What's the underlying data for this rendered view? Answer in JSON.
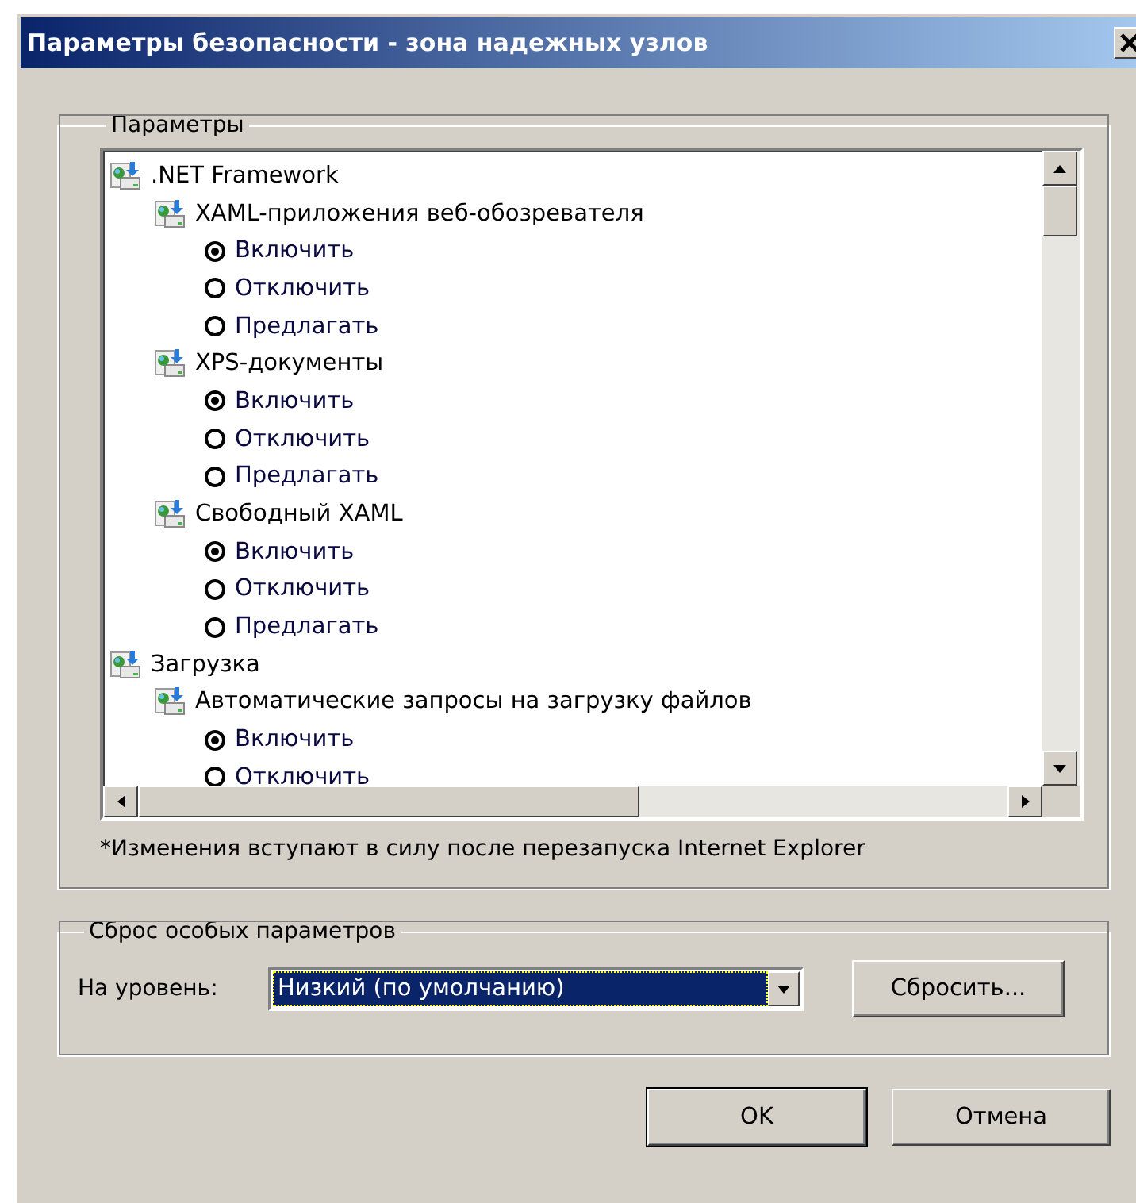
{
  "window": {
    "title": "Параметры безопасности - зона надежных узлов"
  },
  "settings_group": {
    "label": "Параметры",
    "tree": [
      {
        "kind": "group",
        "label": ".NET Framework",
        "children": [
          {
            "kind": "group",
            "label": "XAML-приложения веб-обозревателя",
            "children": [
              {
                "kind": "radio",
                "label": "Включить",
                "selected": true
              },
              {
                "kind": "radio",
                "label": "Отключить",
                "selected": false
              },
              {
                "kind": "radio",
                "label": "Предлагать",
                "selected": false
              }
            ]
          },
          {
            "kind": "group",
            "label": "XPS-документы",
            "children": [
              {
                "kind": "radio",
                "label": "Включить",
                "selected": true
              },
              {
                "kind": "radio",
                "label": "Отключить",
                "selected": false
              },
              {
                "kind": "radio",
                "label": "Предлагать",
                "selected": false
              }
            ]
          },
          {
            "kind": "group",
            "label": "Свободный XAML",
            "children": [
              {
                "kind": "radio",
                "label": "Включить",
                "selected": true
              },
              {
                "kind": "radio",
                "label": "Отключить",
                "selected": false
              },
              {
                "kind": "radio",
                "label": "Предлагать",
                "selected": false
              }
            ]
          }
        ]
      },
      {
        "kind": "group",
        "label": "Загрузка",
        "children": [
          {
            "kind": "group",
            "label": "Автоматические запросы на загрузку файлов",
            "children": [
              {
                "kind": "radio",
                "label": "Включить",
                "selected": true
              },
              {
                "kind": "radio",
                "label": "Отключить",
                "selected": false
              }
            ]
          }
        ]
      }
    ],
    "note": "*Изменения вступают в силу после перезапуска Internet Explorer"
  },
  "reset_group": {
    "label": "Сброс особых параметров",
    "level_label": "На уровень:",
    "level_value": "Низкий (по умолчанию)",
    "reset_button": "Сбросить..."
  },
  "buttons": [
    {
      "label": "OK",
      "default": true
    },
    {
      "label": "Отмена",
      "default": false
    }
  ]
}
